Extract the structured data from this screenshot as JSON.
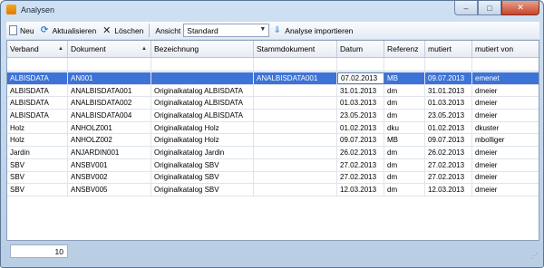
{
  "window": {
    "title": "Analysen",
    "min_glyph": "–",
    "max_glyph": "□",
    "close_glyph": "✕"
  },
  "toolbar": {
    "new_label": "Neu",
    "refresh_label": "Aktualisieren",
    "delete_label": "Löschen",
    "view_label": "Ansicht",
    "view_value": "Standard",
    "import_label": "Analyse importieren"
  },
  "grid": {
    "columns": [
      "Verband",
      "Dokument",
      "Bezeichnung",
      "Stammdokument",
      "Datum",
      "Referenz",
      "mutiert",
      "mutiert von"
    ],
    "rows": [
      [
        "ALBISDATA",
        "AN001",
        "",
        "ANALBISDATA001",
        "07.02.2013",
        "MB",
        "09.07.2013",
        "emenet"
      ],
      [
        "ALBISDATA",
        "ANALBISDATA001",
        "Originalkatalog ALBISDATA",
        "",
        "31.01.2013",
        "dm",
        "31.01.2013",
        "dmeier"
      ],
      [
        "ALBISDATA",
        "ANALBISDATA002",
        "Originalkatalog ALBISDATA",
        "",
        "01.03.2013",
        "dm",
        "01.03.2013",
        "dmeier"
      ],
      [
        "ALBISDATA",
        "ANALBISDATA004",
        "Originalkatalog ALBISDATA",
        "",
        "23.05.2013",
        "dm",
        "23.05.2013",
        "dmeier"
      ],
      [
        "Holz",
        "ANHOLZ001",
        "Originalkatalog Holz",
        "",
        "01.02.2013",
        "dku",
        "01.02.2013",
        "dkuster"
      ],
      [
        "Holz",
        "ANHOLZ002",
        "Originalkatalog Holz",
        "",
        "09.07.2013",
        "MB",
        "09.07.2013",
        "mbolliger"
      ],
      [
        "Jardin",
        "ANJARDIN001",
        "Originalkatalog Jardin",
        "",
        "26.02.2013",
        "dm",
        "26.02.2013",
        "dmeier"
      ],
      [
        "SBV",
        "ANSBV001",
        "Originalkatalog SBV",
        "",
        "27.02.2013",
        "dm",
        "27.02.2013",
        "dmeier"
      ],
      [
        "SBV",
        "ANSBV002",
        "Originalkatalog SBV",
        "",
        "27.02.2013",
        "dm",
        "27.02.2013",
        "dmeier"
      ],
      [
        "SBV",
        "ANSBV005",
        "Originalkatalog SBV",
        "",
        "12.03.2013",
        "dm",
        "12.03.2013",
        "dmeier"
      ]
    ],
    "selected_row": 0,
    "sort": {
      "column": "Verband",
      "direction": "ascending"
    }
  },
  "footer": {
    "count": "10"
  },
  "colors": {
    "selection": "#3d73d6",
    "frame": "#b9cde4",
    "accent_icon": "#f5a623"
  }
}
